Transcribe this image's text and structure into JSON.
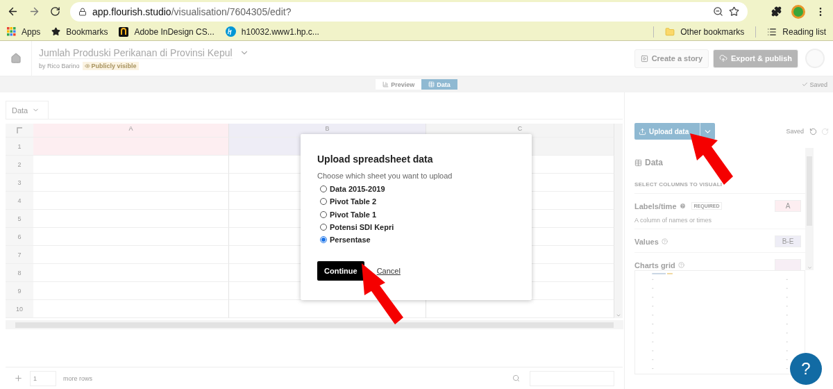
{
  "browser": {
    "url": {
      "host": "app.flourish.studio",
      "path": "/visualisation/7604305/edit?"
    },
    "bookmarks": [
      {
        "kind": "apps",
        "label": "Apps"
      },
      {
        "kind": "star",
        "label": "Bookmarks"
      },
      {
        "kind": "indesign",
        "label": "Adobe InDesign CS..."
      },
      {
        "kind": "hp",
        "label": "h10032.www1.hp.c..."
      }
    ],
    "other_bookmarks": "Other bookmarks",
    "reading_list": "Reading list"
  },
  "header": {
    "title": "Jumlah Produski Perikanan di Provinsi Kepul",
    "author": "by Rico Barino",
    "visibility": "Publicly visible",
    "buttons": [
      {
        "kind": "story",
        "label": "Create a story"
      },
      {
        "kind": "publish",
        "label": "Export & publish"
      }
    ]
  },
  "view_tabs": [
    {
      "kind": "preview",
      "label": "Preview",
      "selected": false
    },
    {
      "kind": "data",
      "label": "Data",
      "selected": true
    }
  ],
  "save_status": "Saved",
  "sheet_tab": "Data",
  "grid": {
    "columns": [
      {
        "label": "A",
        "color": "#fdeef1"
      },
      {
        "label": "B",
        "color": "#eeedf6"
      },
      {
        "label": "C",
        "color": "#f4f4f4"
      }
    ],
    "rows": [
      "1",
      "2",
      "3",
      "4",
      "5",
      "6",
      "7",
      "8",
      "9",
      "10"
    ]
  },
  "footer": {
    "add_rows": "1",
    "more_rows": "more rows"
  },
  "dialog": {
    "title": "Upload spreadsheet data",
    "subtitle": "Choose which sheet you want to upload",
    "options": [
      {
        "label": "Data 2015-2019",
        "selected": false
      },
      {
        "label": "Pivot Table 2",
        "selected": false
      },
      {
        "label": "Pivot Table 1",
        "selected": false
      },
      {
        "label": "Potensi SDI Kepri",
        "selected": false
      },
      {
        "label": "Persentase",
        "selected": true
      }
    ],
    "confirm": "Continue",
    "cancel": "Cancel"
  },
  "side_panel": {
    "upload": "Upload data",
    "status": "Saved",
    "section": "Data",
    "heading": "SELECT COLUMNS TO VISUALI",
    "bindings": [
      {
        "label": "Labels/time",
        "badge": "REQUIRED",
        "hint": "A column of names or times",
        "value": "A",
        "color": "#fdeef1"
      },
      {
        "label": "Values",
        "value": "B-E",
        "color": "#eeedf6"
      },
      {
        "label": "Charts grid",
        "color": "#f7eef5"
      }
    ]
  },
  "help": "?"
}
